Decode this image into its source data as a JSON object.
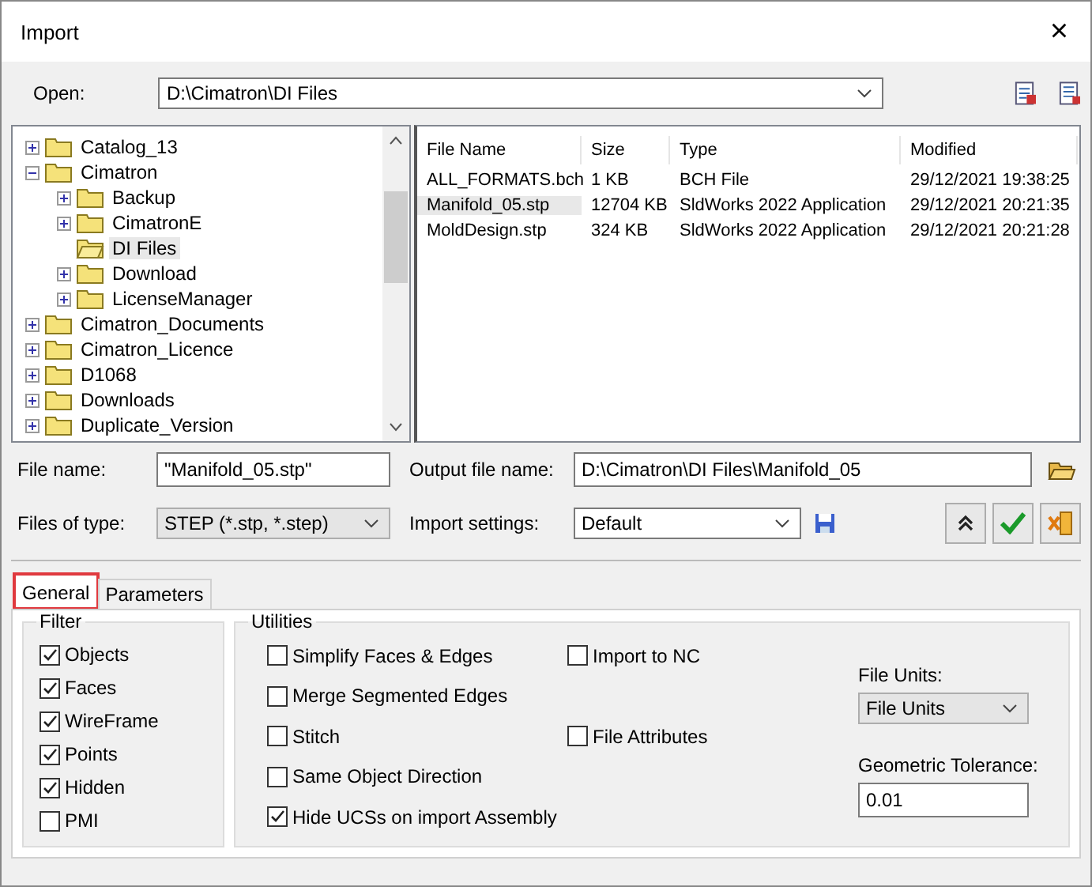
{
  "window": {
    "title": "Import",
    "close": "×"
  },
  "open": {
    "label": "Open:",
    "value": "D:\\Cimatron\\DI Files"
  },
  "tree": [
    {
      "label": "Catalog_13",
      "kind": "collapsed",
      "selected": false
    },
    {
      "label": "Cimatron",
      "kind": "expanded",
      "selected": false,
      "children": [
        {
          "label": "Backup",
          "kind": "collapsed",
          "selected": false
        },
        {
          "label": "CimatronE",
          "kind": "collapsed",
          "selected": false
        },
        {
          "label": "DI Files",
          "kind": "leaf",
          "selected": true
        },
        {
          "label": "Download",
          "kind": "collapsed",
          "selected": false
        },
        {
          "label": "LicenseManager",
          "kind": "collapsed",
          "selected": false
        }
      ]
    },
    {
      "label": "Cimatron_Documents",
      "kind": "collapsed",
      "selected": false
    },
    {
      "label": "Cimatron_Licence",
      "kind": "collapsed",
      "selected": false
    },
    {
      "label": "D1068",
      "kind": "collapsed",
      "selected": false
    },
    {
      "label": "Downloads",
      "kind": "collapsed",
      "selected": false
    },
    {
      "label": "Duplicate_Version",
      "kind": "collapsed",
      "selected": false
    }
  ],
  "files": {
    "columns": [
      "File Name",
      "Size",
      "Type",
      "Modified"
    ],
    "rows": [
      {
        "cells": [
          "ALL_FORMATS.bch",
          "1 KB",
          "BCH File",
          "29/12/2021 19:38:25"
        ],
        "selected": false
      },
      {
        "cells": [
          "Manifold_05.stp",
          "12704 KB",
          "SldWorks 2022 Application",
          "29/12/2021 20:21:35"
        ],
        "selected": true
      },
      {
        "cells": [
          "MoldDesign.stp",
          "324 KB",
          "SldWorks 2022 Application",
          "29/12/2021 20:21:28"
        ],
        "selected": false
      }
    ]
  },
  "file_name": {
    "label": "File name:",
    "value": "\"Manifold_05.stp\""
  },
  "output_file_name": {
    "label": "Output file name:",
    "value": "D:\\Cimatron\\DI Files\\Manifold_05"
  },
  "files_of_type": {
    "label": "Files of type:",
    "value": "STEP (*.stp, *.step)"
  },
  "import_settings": {
    "label": "Import settings:",
    "value": "Default"
  },
  "tabs": [
    {
      "label": "General",
      "selected": true,
      "highlighted": true
    },
    {
      "label": "Parameters",
      "selected": false,
      "highlighted": false
    }
  ],
  "filter": {
    "title": "Filter",
    "items": [
      {
        "label": "Objects",
        "checked": true
      },
      {
        "label": "Faces",
        "checked": true
      },
      {
        "label": "WireFrame",
        "checked": true
      },
      {
        "label": "Points",
        "checked": true
      },
      {
        "label": "Hidden",
        "checked": true
      },
      {
        "label": "PMI",
        "checked": false
      }
    ]
  },
  "utilities": {
    "title": "Utilities",
    "left": [
      {
        "label": "Simplify Faces & Edges",
        "checked": false
      },
      {
        "label": "Merge Segmented Edges",
        "checked": false
      },
      {
        "label": "Stitch",
        "checked": false
      },
      {
        "label": "Same Object Direction",
        "checked": false
      },
      {
        "label": "Hide UCSs on import Assembly",
        "checked": true
      }
    ],
    "right": [
      {
        "label": "Import to NC",
        "checked": false
      },
      {
        "label": "File Attributes",
        "checked": false
      }
    ]
  },
  "file_units": {
    "label": "File Units:",
    "value": "File Units"
  },
  "geometric_tolerance": {
    "label": "Geometric Tolerance:",
    "value": "0.01"
  }
}
